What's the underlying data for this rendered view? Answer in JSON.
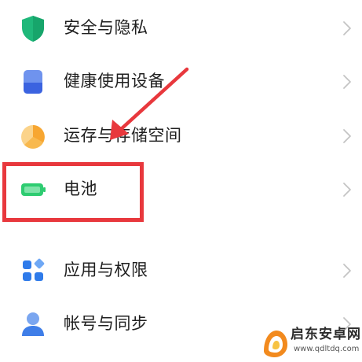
{
  "settings": {
    "items": [
      {
        "label": "安全与隐私",
        "icon": "shield-icon",
        "icon_color": "#1fb87a"
      },
      {
        "label": "健康使用设备",
        "icon": "health-device-icon",
        "icon_color": "#3b63e0"
      },
      {
        "label": "运存与存储空间",
        "icon": "storage-pie-icon",
        "icon_color": "#f7a631"
      },
      {
        "label": "电池",
        "icon": "battery-icon",
        "icon_color": "#2ecc71"
      },
      {
        "label": "应用与权限",
        "icon": "apps-grid-icon",
        "icon_color": "#2f7bea"
      },
      {
        "label": "帐号与同步",
        "icon": "account-person-icon",
        "icon_color": "#3f7ee8"
      }
    ]
  },
  "annotation": {
    "highlight_color": "#e8383d",
    "highlighted_item": "电池"
  },
  "watermark": {
    "brand": "启东安卓网",
    "url": "www.qdltdq.com"
  }
}
